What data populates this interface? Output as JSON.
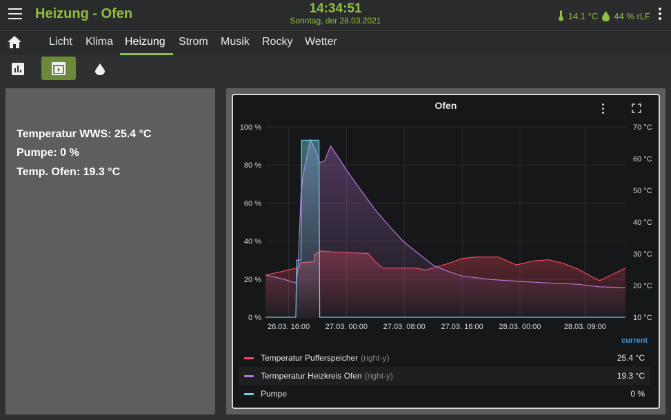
{
  "header": {
    "title": "Heizung - Ofen",
    "time": "14:34:51",
    "date": "Sonntag, der 28.03.2021",
    "temperature": "14.1 °C",
    "humidity": "44 % rLF",
    "accent_color": "#8fc03f"
  },
  "nav": {
    "home_icon": "home-icon",
    "tabs": [
      {
        "label": "Licht"
      },
      {
        "label": "Klima"
      },
      {
        "label": "Heizung",
        "active": true
      },
      {
        "label": "Strom"
      },
      {
        "label": "Musik"
      },
      {
        "label": "Rocky"
      },
      {
        "label": "Wetter"
      }
    ]
  },
  "subnav": {
    "buttons": [
      {
        "icon": "bar-chart-icon"
      },
      {
        "icon": "fireplace-icon",
        "active": true
      },
      {
        "icon": "water-drop-icon"
      }
    ]
  },
  "info": {
    "lines": [
      "Temperatur WWS: 25.4 °C",
      "Pumpe: 0 %",
      "Temp. Ofen: 19.3 °C"
    ]
  },
  "chart_data": {
    "type": "line",
    "title": "Ofen",
    "left_axis": {
      "ticks": [
        "0 %",
        "20 %",
        "40 %",
        "60 %",
        "80 %",
        "100 %"
      ],
      "range": [
        0,
        100
      ],
      "unit": "%"
    },
    "right_axis": {
      "ticks": [
        "10 °C",
        "20 °C",
        "30 °C",
        "40 °C",
        "50 °C",
        "60 °C",
        "70 °C"
      ],
      "range": [
        10,
        70
      ],
      "unit": "°C"
    },
    "x_ticks": [
      "26.03. 16:00",
      "27.03. 00:00",
      "27.03. 08:00",
      "27.03. 16:00",
      "28.03. 00:00",
      "28.03. 09:00"
    ],
    "x_tick_hours": [
      0,
      8,
      16,
      24,
      32,
      41
    ],
    "x_range_hours": [
      -3.2,
      46.6
    ],
    "grid": true,
    "legend_header": "current",
    "series": [
      {
        "name": "Temperatur Pufferspeicher",
        "axis": "right-y",
        "color": "#f2495c",
        "current": "25.4 °C",
        "x": [
          -3.2,
          -1.0,
          1.0,
          1.5,
          1.6,
          3.5,
          3.6,
          4.5,
          6.0,
          8.0,
          11.0,
          12.0,
          13.0,
          14.0,
          17.5,
          19.0,
          22.0,
          24.0,
          26.0,
          29.0,
          31.5,
          34.0,
          36.0,
          38.0,
          40.0,
          43.0,
          46.6
        ],
        "values": [
          23.3,
          24.4,
          25.5,
          25.7,
          27.2,
          27.5,
          29.8,
          30.9,
          30.6,
          30.4,
          30.1,
          27.5,
          25.5,
          25.5,
          25.5,
          24.9,
          26.9,
          28.5,
          29.0,
          29.0,
          26.5,
          27.8,
          28.1,
          27.0,
          25.2,
          21.5,
          25.5
        ]
      },
      {
        "name": "Termperatur Heizkreis Ofen",
        "axis": "right-y",
        "color": "#b877d9",
        "current": "19.3 °C",
        "x": [
          -3.2,
          -1.0,
          1.0,
          1.3,
          1.7,
          2.0,
          3.0,
          3.6,
          4.3,
          5.0,
          5.8,
          7.0,
          8.0,
          10.0,
          12.0,
          14.0,
          16.0,
          18.0,
          20.0,
          22.0,
          24.0,
          28.0,
          32.0,
          36.0,
          40.0,
          43.0,
          46.6
        ],
        "values": [
          23.3,
          22.2,
          20.8,
          25.5,
          48.6,
          54.9,
          66.0,
          63.3,
          58.7,
          59.4,
          64.0,
          60.0,
          56.4,
          50.0,
          43.8,
          38.5,
          33.6,
          30.0,
          26.4,
          24.5,
          23.0,
          21.9,
          21.3,
          20.8,
          20.4,
          19.6,
          19.3
        ]
      },
      {
        "name": "Pumpe",
        "axis": "left-y",
        "color": "#6ed0e0",
        "current": "0 %",
        "x": [
          -3.2,
          1.0,
          1.1,
          1.7,
          1.8,
          4.2,
          4.3,
          46.6
        ],
        "values": [
          0,
          0,
          30,
          30,
          93,
          93,
          0,
          0
        ]
      }
    ]
  }
}
